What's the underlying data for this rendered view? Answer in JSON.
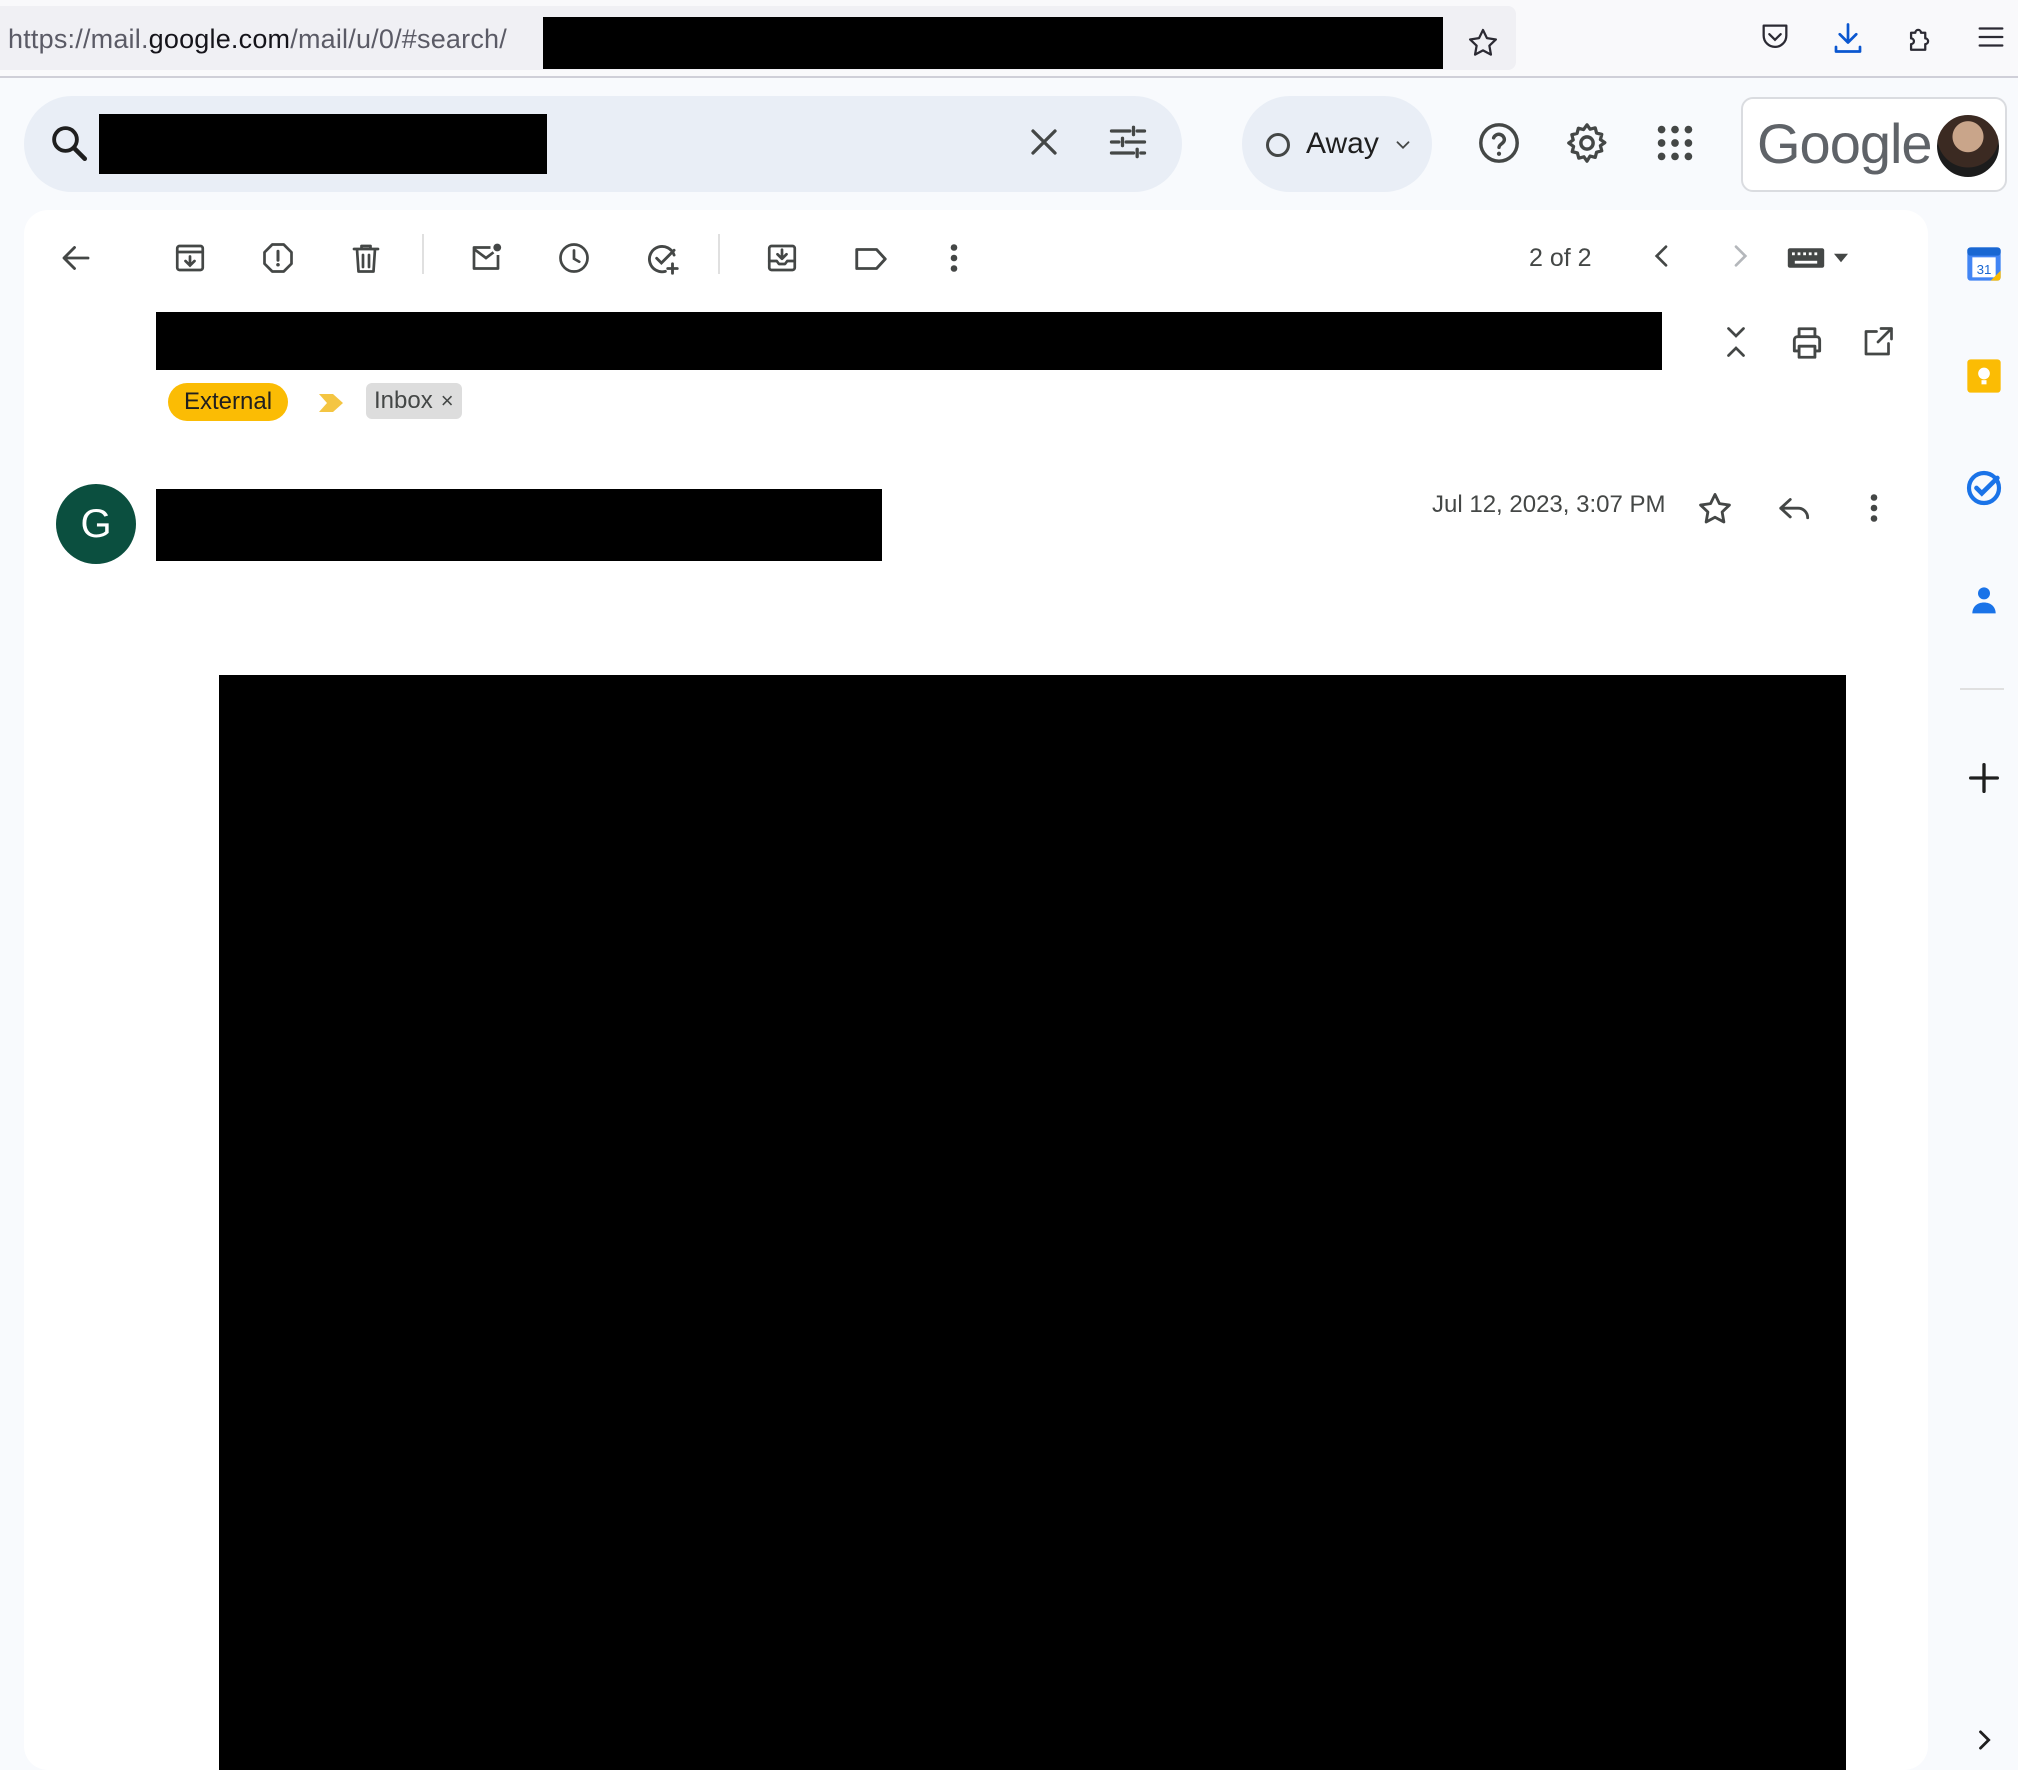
{
  "browser": {
    "url_prefix": "https://mail.",
    "url_domain": "google.com",
    "url_suffix": "/mail/u/0/#search/"
  },
  "header": {
    "status_label": "Away",
    "brand_name": "Google"
  },
  "toolbar": {
    "pager_text": "2 of 2"
  },
  "labels": {
    "external": "External",
    "inbox": "Inbox",
    "inbox_remove": "×"
  },
  "message": {
    "sender_initial": "G",
    "date": "Jul 12, 2023, 3:07 PM"
  },
  "colors": {
    "accent_blue": "#0b57d0",
    "external_label": "#fbbc04",
    "sender_avatar": "#0b4f3f"
  },
  "icons": {
    "browser": [
      "bookmark-star-icon",
      "pocket-icon",
      "download-icon",
      "extensions-icon",
      "menu-icon"
    ],
    "header": [
      "search-icon",
      "clear-icon",
      "search-options-icon",
      "help-icon",
      "settings-icon",
      "apps-icon"
    ],
    "toolbar": [
      "back-icon",
      "archive-icon",
      "report-spam-icon",
      "delete-icon",
      "mark-unread-icon",
      "snooze-icon",
      "add-task-icon",
      "move-to-icon",
      "label-icon",
      "more-icon",
      "prev-icon",
      "next-icon",
      "keyboard-icon"
    ],
    "side_panel": [
      "calendar-icon",
      "keep-icon",
      "tasks-icon",
      "contacts-icon",
      "add-icon",
      "expand-panel-icon"
    ]
  }
}
